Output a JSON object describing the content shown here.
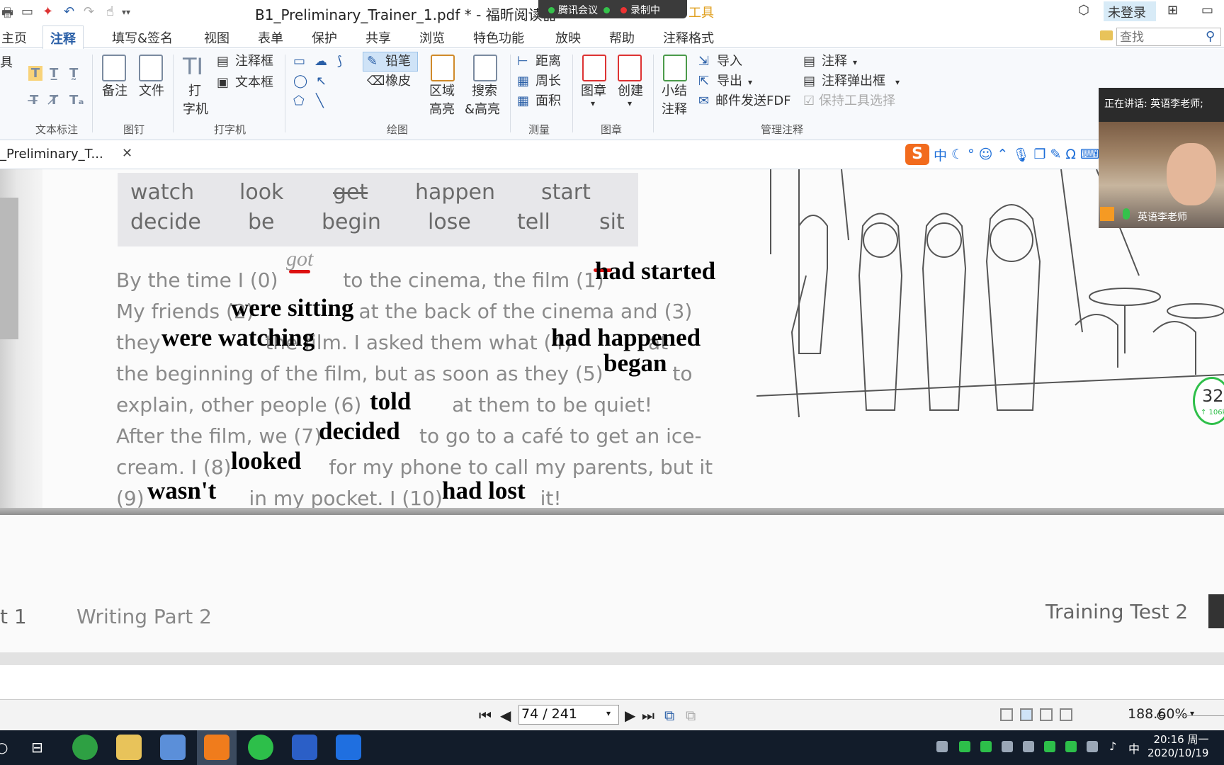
{
  "window": {
    "title": "B1_Preliminary_Trainer_1.pdf * - 福昕阅读器",
    "login": "未登录",
    "ghost_text": "工具"
  },
  "meeting": {
    "app": "腾讯会议",
    "recording": "录制中"
  },
  "menu": {
    "tabs": [
      "主页",
      "注释",
      "填写&签名",
      "视图",
      "表单",
      "保护",
      "共享",
      "浏览",
      "特色功能",
      "放映",
      "帮助",
      "注释格式"
    ],
    "search_placeholder": "查找"
  },
  "ribbon": {
    "left_edge": "具",
    "groups": [
      "文本标注",
      "图钉",
      "打字机",
      "绘图",
      "测量",
      "图章",
      "管理注释"
    ],
    "note": "备注",
    "file": "文件",
    "typewriter1": "打",
    "typewriter2": "字机",
    "callout": "注释框",
    "textbox": "文本框",
    "pencil": "铅笔",
    "eraser": "橡皮",
    "area1": "区域",
    "area2": "高亮",
    "search1": "搜索",
    "search2": "&高亮",
    "distance": "距离",
    "perimeter": "周长",
    "area": "面积",
    "stamp": "图章",
    "create": "创建",
    "summary1": "小结",
    "summary2": "注释",
    "import": "导入",
    "export": "导出",
    "email": "邮件发送FDF",
    "annotate": "注释",
    "popup": "注释弹出框",
    "keep_tool": "保持工具选择"
  },
  "doc_tab": {
    "name": "_Preliminary_T...",
    "close": "✕"
  },
  "ime": {
    "logo": "S",
    "mode": "中"
  },
  "page": {
    "words_row1": [
      "watch",
      "look",
      "get",
      "happen",
      "start"
    ],
    "words_row2": [
      "decide",
      "be",
      "begin",
      "lose",
      "tell",
      "sit"
    ],
    "lines": [
      "By the time I (0) ",
      "got",
      " to the cinema, the film (1) ",
      "My friends (2) ",
      " at the back of the cinema and (3)",
      "they ",
      " the film. I asked them what (4) ",
      " at",
      "the beginning of the film, but as soon as they (5) ",
      " to",
      "explain, other people (6) ",
      " at them to be quiet!",
      "After the film, we (7) ",
      " to go to a café to get an ice-",
      "cream. I (8) ",
      " for my phone to call my parents, but it",
      "(9) ",
      " in my pocket. I (10) ",
      " it!"
    ],
    "answers": [
      "had started",
      "were sitting",
      "were watching",
      "had happened",
      "began",
      "told",
      "decided",
      "looked",
      "wasn't",
      "had lost"
    ],
    "footer_left_partial": "t 1",
    "footer_left": "Writing Part 2",
    "footer_right": "Training  Test 2"
  },
  "video": {
    "speaking": "正在讲话: 英语李老师;",
    "name": "英语李老师"
  },
  "gauge": {
    "value": "32",
    "speed": "↑ 106k"
  },
  "status": {
    "page": "74 / 241",
    "zoom": "188.60%"
  },
  "taskbar": {
    "time": "20:16 周一",
    "date": "2020/10/19",
    "ime": "中"
  }
}
